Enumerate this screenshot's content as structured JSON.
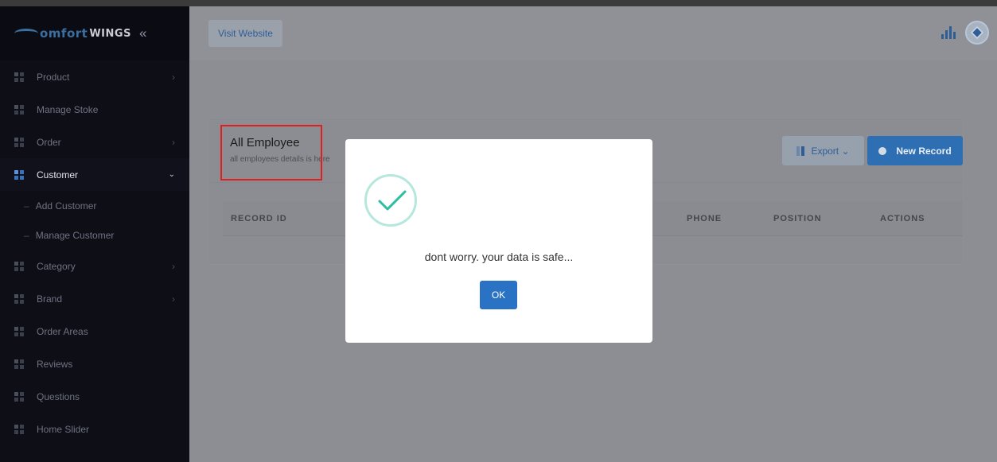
{
  "brand": {
    "name_part1": "omfort",
    "name_part2": "WINGS",
    "collapse_symbol": "«"
  },
  "sidebar": {
    "items": [
      {
        "label": "Product",
        "arrow": "›"
      },
      {
        "label": "Manage Stoke",
        "arrow": ""
      },
      {
        "label": "Order",
        "arrow": "›"
      },
      {
        "label": "Customer",
        "arrow": "⌄",
        "active": true
      },
      {
        "label": "Category",
        "arrow": "›"
      },
      {
        "label": "Brand",
        "arrow": "›"
      },
      {
        "label": "Order Areas",
        "arrow": ""
      },
      {
        "label": "Reviews",
        "arrow": ""
      },
      {
        "label": "Questions",
        "arrow": ""
      },
      {
        "label": "Home Slider",
        "arrow": ""
      }
    ],
    "subitems": [
      {
        "label": "Add Customer"
      },
      {
        "label": "Manage Customer"
      }
    ]
  },
  "header": {
    "visit_label": "Visit Website",
    "stats_icon": "bar-chart-icon",
    "user_icon": "user-avatar-icon"
  },
  "card": {
    "title": "All Employee",
    "subtitle": "all employees details is here",
    "export_label": "Export ⌄",
    "new_label": "New Record",
    "columns": [
      "RECORD ID",
      "PHONE",
      "POSITION",
      "ACTIONS"
    ]
  },
  "modal": {
    "message": "dont worry. your data is safe...",
    "ok_label": "OK",
    "icon": "success-check-icon"
  },
  "colors": {
    "accent": "#2a73c4",
    "highlight_border": "#e02020",
    "check": "#2bbf9f"
  }
}
